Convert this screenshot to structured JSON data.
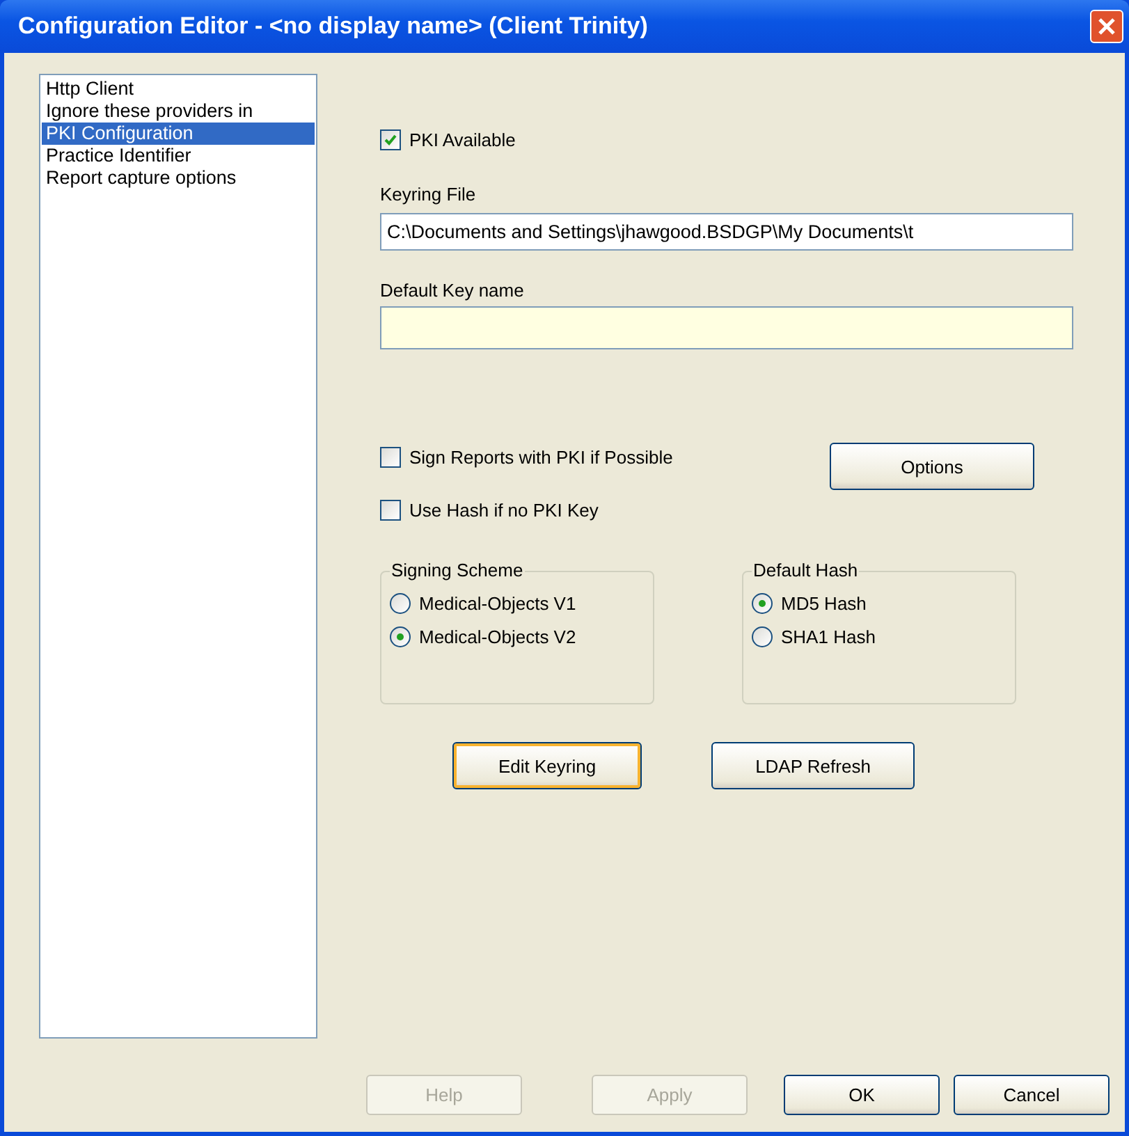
{
  "window": {
    "title": "Configuration Editor - <no display name> (Client Trinity)"
  },
  "sidebar": {
    "items": [
      {
        "label": "Http Client",
        "selected": false
      },
      {
        "label": "Ignore these providers in",
        "selected": false
      },
      {
        "label": "PKI Configuration",
        "selected": true
      },
      {
        "label": "Practice Identifier",
        "selected": false
      },
      {
        "label": "Report capture options",
        "selected": false
      }
    ]
  },
  "pki_available": {
    "label": "PKI Available",
    "checked": true
  },
  "keyring_file": {
    "label": "Keyring File",
    "value": "C:\\Documents and Settings\\jhawgood.BSDGP\\My Documents\\t"
  },
  "default_key_name": {
    "label": "Default Key name"
  },
  "signing_options": [
    {
      "label": "Sign Reports with PKI if Possible",
      "checked": false
    },
    {
      "label": "Use Hash if no PKI Key",
      "checked": false
    }
  ],
  "options_button": {
    "label": "Options"
  },
  "groups": [
    {
      "title": "Signing Scheme",
      "options": [
        {
          "label": "Medical-Objects V1",
          "selected": false
        },
        {
          "label": "Medical-Objects V2",
          "selected": true
        }
      ]
    },
    {
      "title": "Default Hash",
      "options": [
        {
          "label": "MD5 Hash",
          "selected": true
        },
        {
          "label": "SHA1 Hash",
          "selected": false
        }
      ]
    }
  ],
  "action_buttons": [
    {
      "label": "Edit Keyring",
      "focused": true
    },
    {
      "label": "LDAP Refresh",
      "focused": false
    }
  ],
  "footer_buttons": [
    {
      "label": "Help",
      "disabled": true
    },
    {
      "label": "Apply",
      "disabled": true
    },
    {
      "label": "OK",
      "disabled": false
    },
    {
      "label": "Cancel",
      "disabled": false
    }
  ]
}
